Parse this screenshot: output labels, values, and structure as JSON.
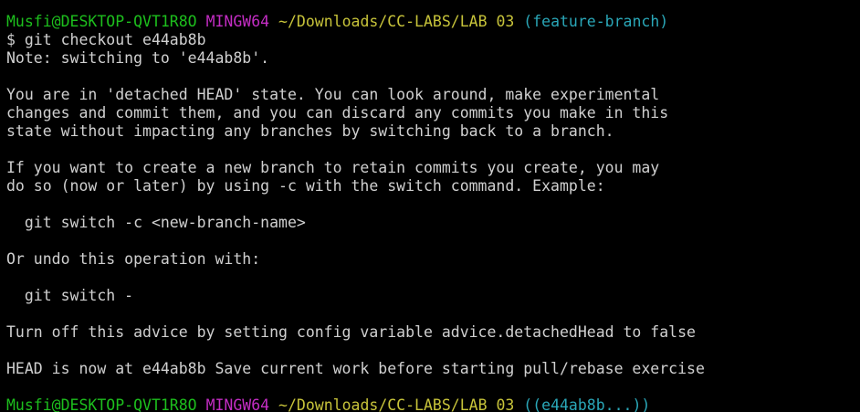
{
  "prompt1": {
    "user": "Musfi@DESKTOP-QVT1R8O",
    "env": "MINGW64",
    "path": "~/Downloads/CC-LABS/LAB 03",
    "branch": "(feature-branch)"
  },
  "command": "$ git checkout e44ab8b",
  "output": [
    "Note: switching to 'e44ab8b'.",
    "",
    "You are in 'detached HEAD' state. You can look around, make experimental",
    "changes and commit them, and you can discard any commits you make in this",
    "state without impacting any branches by switching back to a branch.",
    "",
    "If you want to create a new branch to retain commits you create, you may",
    "do so (now or later) by using -c with the switch command. Example:",
    "",
    "  git switch -c <new-branch-name>",
    "",
    "Or undo this operation with:",
    "",
    "  git switch -",
    "",
    "Turn off this advice by setting config variable advice.detachedHead to false",
    "",
    "HEAD is now at e44ab8b Save current work before starting pull/rebase exercise"
  ],
  "prompt2": {
    "user": "Musfi@DESKTOP-QVT1R8O",
    "env": "MINGW64",
    "path": "~/Downloads/CC-LABS/LAB 03",
    "branch": "((e44ab8b...))"
  },
  "colors": {
    "background": "#000000",
    "text": "#d0d0d0",
    "user": "#1dbf1d",
    "env": "#c32dc3",
    "path": "#c7c33a",
    "branch": "#2aa7b8"
  }
}
